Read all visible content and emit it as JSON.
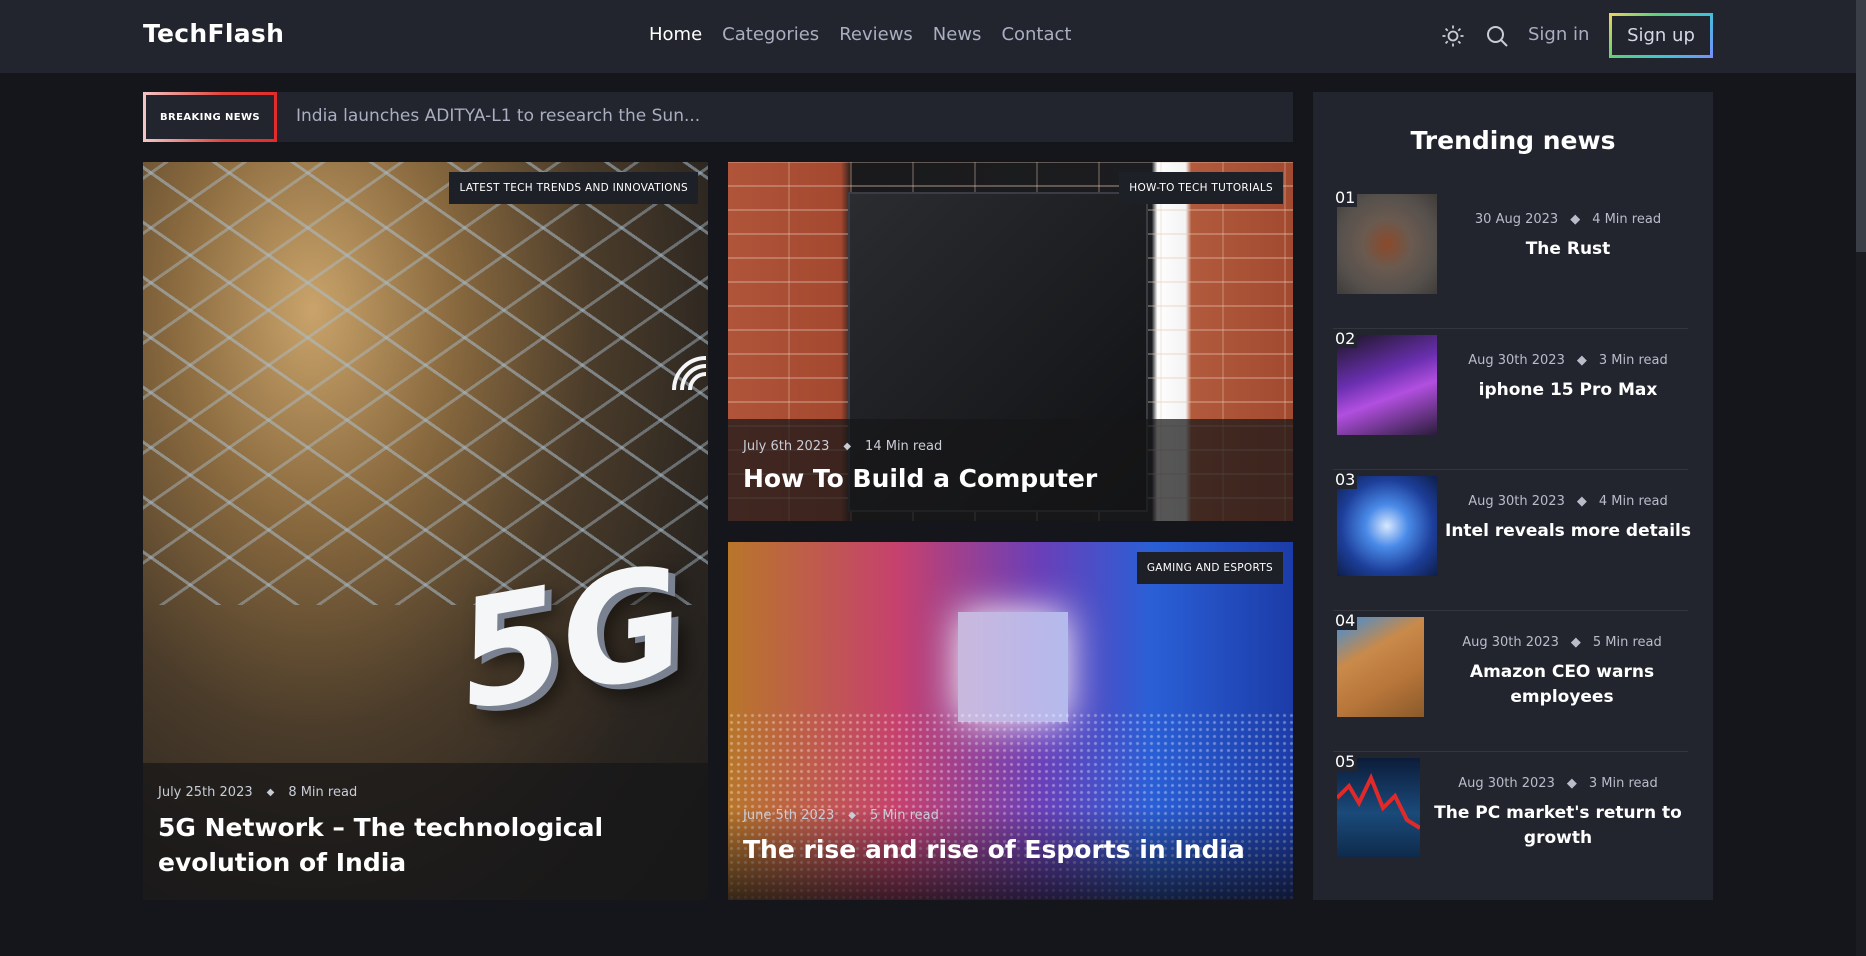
{
  "brand": {
    "name": "TechFlash"
  },
  "nav": {
    "items": [
      {
        "label": "Home",
        "active": true
      },
      {
        "label": "Categories",
        "active": false
      },
      {
        "label": "Reviews",
        "active": false
      },
      {
        "label": "News",
        "active": false
      },
      {
        "label": "Contact",
        "active": false
      }
    ]
  },
  "header_actions": {
    "theme_icon": "sun-icon",
    "search_icon": "search-icon",
    "signin_label": "Sign in",
    "signup_label": "Sign up"
  },
  "breaking": {
    "badge": "BREAKING NEWS",
    "headline": "India launches ADITYA-L1 to research the Sun..."
  },
  "featured": [
    {
      "tag": "LATEST TECH TRENDS AND INNOVATIONS",
      "date": "July 25th 2023",
      "read": "8 Min read",
      "title": "5G Network – The technological evolution of India",
      "image_text": "5G"
    },
    {
      "tag": "HOW-TO TECH TUTORIALS",
      "date": "July 6th 2023",
      "read": "14 Min read",
      "title": "How To Build a Computer"
    },
    {
      "tag": "GAMING AND ESPORTS",
      "date": "June 5th 2023",
      "read": "5 Min read",
      "title": "The rise and rise of Esports in India"
    }
  ],
  "trending": {
    "title": "Trending news",
    "items": [
      {
        "num": "01",
        "date": "30 Aug 2023",
        "read": "4 Min read",
        "title": "The Rust"
      },
      {
        "num": "02",
        "date": "Aug 30th 2023",
        "read": "3 Min read",
        "title": "iphone 15 Pro Max"
      },
      {
        "num": "03",
        "date": "Aug 30th 2023",
        "read": "4 Min read",
        "title": "Intel reveals more details"
      },
      {
        "num": "04",
        "date": "Aug 30th 2023",
        "read": "5 Min read",
        "title": "Amazon CEO warns employees"
      },
      {
        "num": "05",
        "date": "Aug 30th 2023",
        "read": "3 Min read",
        "title": "The PC market's return to growth"
      }
    ]
  },
  "colors": {
    "background": "#14161b",
    "panel": "#22252e",
    "accent_red": "#e22b2b",
    "text_muted": "#a9aec0"
  }
}
